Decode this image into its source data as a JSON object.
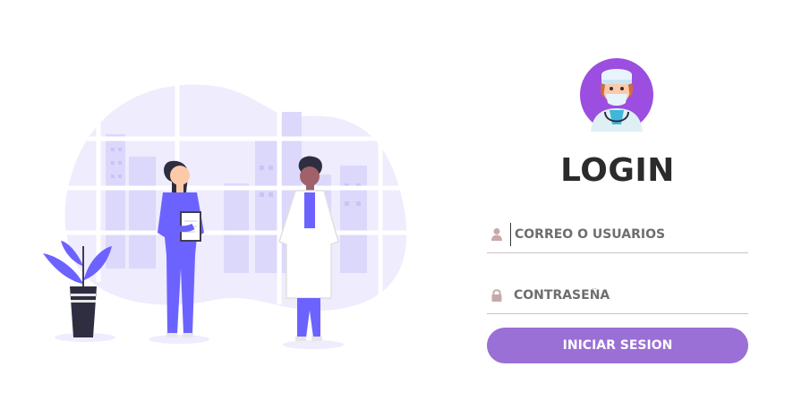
{
  "login": {
    "title": "LOGIN",
    "username": {
      "placeholder": "CORREO O USUARIOS",
      "value": "",
      "icon": "user-icon"
    },
    "password": {
      "placeholder": "CONTRASEÑA",
      "value": "",
      "icon": "lock-icon"
    },
    "submit_label": "INICIAR SESION"
  },
  "colors": {
    "accent": "#9a6fd6",
    "illustration_purple": "#6c63ff",
    "field_icon": "#c8a9a9",
    "field_line": "#c9c2c6",
    "title_text": "#2b2b2b"
  },
  "icons": [
    "doctor-avatar-icon",
    "user-icon",
    "lock-icon",
    "plant-icon"
  ]
}
